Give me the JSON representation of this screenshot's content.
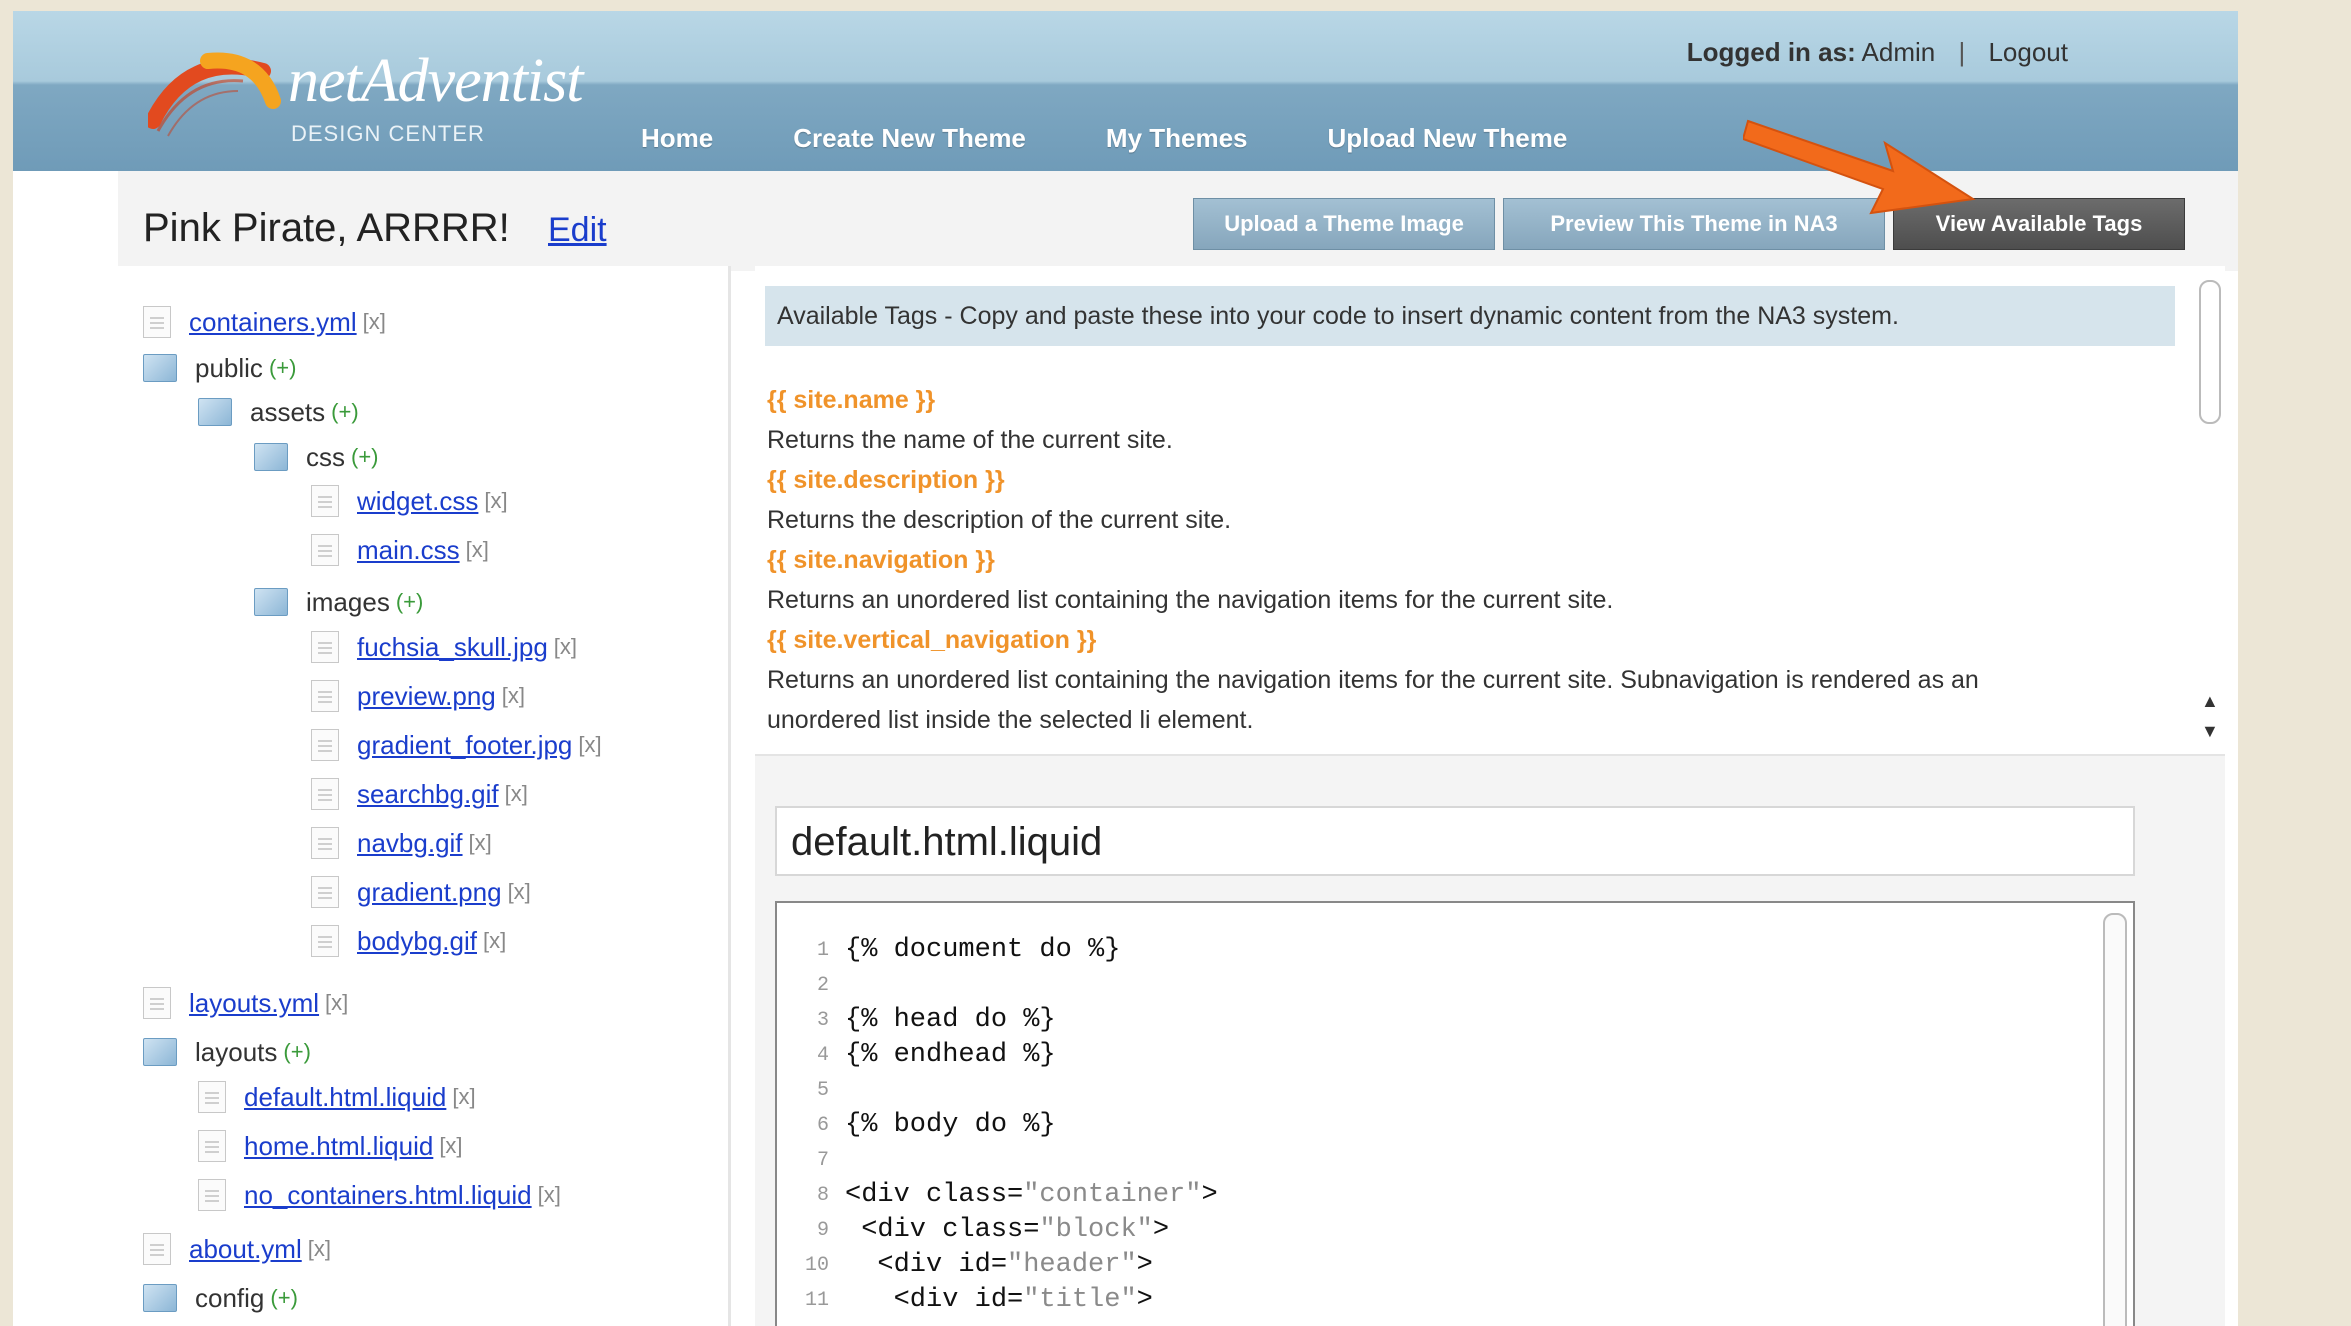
{
  "header": {
    "logo_name": "netAdventist",
    "logo_sub": "DESIGN CENTER",
    "logged_in_label": "Logged in as:",
    "logged_in_user": "Admin",
    "logout": "Logout",
    "nav": [
      "Home",
      "Create New Theme",
      "My Themes",
      "Upload New Theme"
    ]
  },
  "page": {
    "title": "Pink Pirate, ARRRR!",
    "edit": "Edit",
    "buttons": {
      "upload_image": "Upload a Theme Image",
      "preview": "Preview This Theme in NA3",
      "view_tags": "View Available Tags"
    }
  },
  "tree": {
    "containers_yml": "containers.yml",
    "public": "public",
    "assets": "assets",
    "css": "css",
    "widget_css": "widget.css",
    "main_css": "main.css",
    "images": "images",
    "fuchsia": "fuchsia_skull.jpg",
    "preview_png": "preview.png",
    "gradient_footer": "gradient_footer.jpg",
    "searchbg": "searchbg.gif",
    "navbg": "navbg.gif",
    "gradient_png": "gradient.png",
    "bodybg": "bodybg.gif",
    "layouts_yml": "layouts.yml",
    "layouts": "layouts",
    "default_liquid": "default.html.liquid",
    "home_liquid": "home.html.liquid",
    "no_containers_liquid": "no_containers.html.liquid",
    "about_yml": "about.yml",
    "config": "config",
    "x": "[x]",
    "plus": "(+)"
  },
  "tags": {
    "banner": "Available Tags - Copy and paste these into your code to insert dynamic content from the NA3 system.",
    "items": [
      {
        "tag": "{{ site.name }}",
        "desc": "Returns the name of the current site."
      },
      {
        "tag": "{{ site.description }}",
        "desc": "Returns the description of the current site."
      },
      {
        "tag": "{{ site.navigation }}",
        "desc": "Returns an unordered list containing the navigation items for the current site."
      },
      {
        "tag": "{{ site.vertical_navigation }}",
        "desc": "Returns an unordered list containing the navigation items for the current site. Subnavigation is rendered as an",
        "desc2": "unordered list inside the selected li element."
      }
    ]
  },
  "editor": {
    "filename": "default.html.liquid",
    "lines": [
      {
        "n": "1",
        "code": "{% document do %}",
        "str": ""
      },
      {
        "n": "2",
        "code": "",
        "str": ""
      },
      {
        "n": "3",
        "code": "{% head do %}",
        "str": ""
      },
      {
        "n": "4",
        "code": "{% endhead %}",
        "str": ""
      },
      {
        "n": "5",
        "code": "",
        "str": ""
      },
      {
        "n": "6",
        "code": "{% body do %}",
        "str": ""
      },
      {
        "n": "7",
        "code": "",
        "str": ""
      },
      {
        "n": "8",
        "code": "<div class=",
        "str": "\"container\"",
        "end": ">"
      },
      {
        "n": "9",
        "code": " <div class=",
        "str": "\"block\"",
        "end": ">"
      },
      {
        "n": "10",
        "code": "  <div id=",
        "str": "\"header\"",
        "end": ">"
      },
      {
        "n": "11",
        "code": "   <div id=",
        "str": "\"title\"",
        "end": ">"
      }
    ]
  },
  "colors": {
    "accent_orange": "#f0932a",
    "arrow": "#f26a1b",
    "link": "#1a3dcc"
  }
}
